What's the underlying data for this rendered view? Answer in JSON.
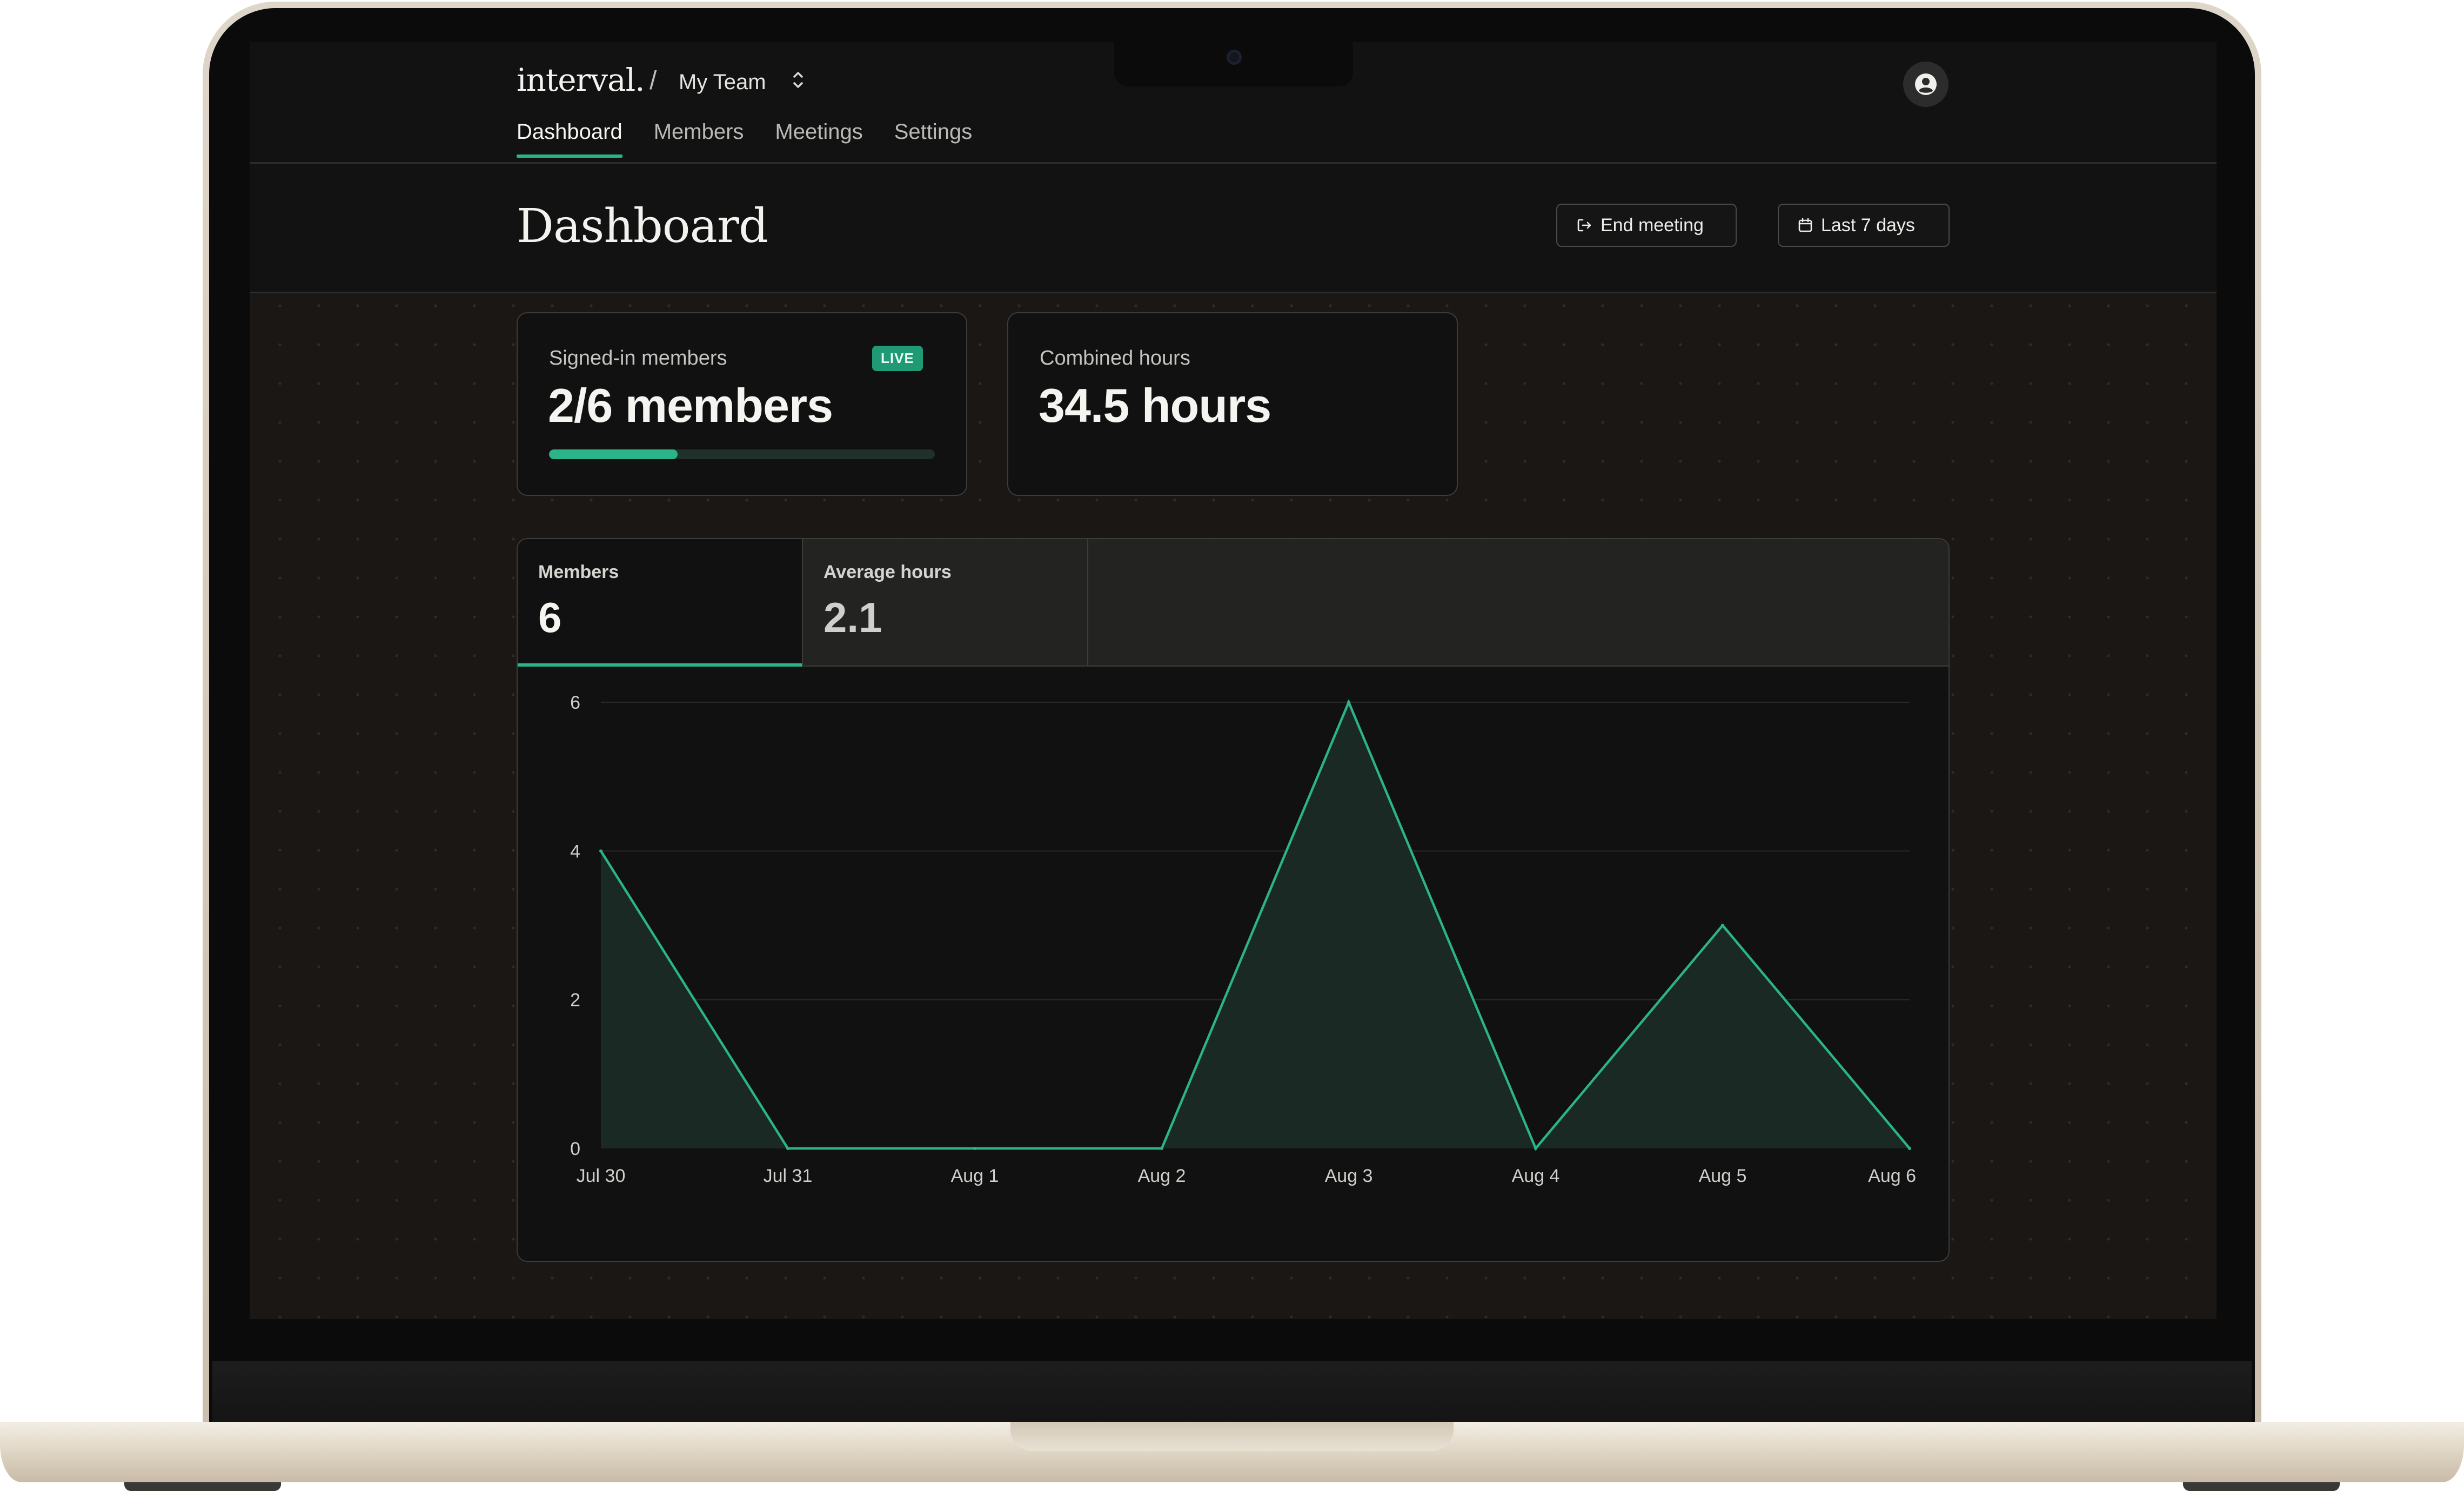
{
  "app": {
    "logo": "interval.",
    "team_separator": "/",
    "team_name": "My Team"
  },
  "nav": {
    "items": [
      {
        "label": "Dashboard",
        "active": true
      },
      {
        "label": "Members",
        "active": false
      },
      {
        "label": "Meetings",
        "active": false
      },
      {
        "label": "Settings",
        "active": false
      }
    ]
  },
  "header": {
    "title": "Dashboard",
    "end_meeting_label": "End meeting",
    "date_range_label": "Last 7 days"
  },
  "stats": {
    "signed_in": {
      "label": "Signed-in members",
      "badge": "LIVE",
      "value": "2/6 members",
      "progress_fraction": 0.333
    },
    "combined": {
      "label": "Combined hours",
      "value": "34.5 hours"
    }
  },
  "tabs": [
    {
      "label": "Members",
      "value": "6",
      "active": true
    },
    {
      "label": "Average hours",
      "value": "2.1",
      "active": false
    }
  ],
  "icons": {
    "team_switcher": "chevron-up-down-icon",
    "avatar": "user-circle-icon",
    "end_meeting": "sign-out-icon",
    "date_range": "calendar-icon"
  },
  "colors": {
    "accent": "#2bb38a",
    "badge": "#1f9a74",
    "area_fill": "#1a2924"
  },
  "chart_data": {
    "type": "area",
    "categories": [
      "Jul 30",
      "Jul 31",
      "Aug 1",
      "Aug 2",
      "Aug 3",
      "Aug 4",
      "Aug 5",
      "Aug 6"
    ],
    "series": [
      {
        "values": [
          4,
          0,
          0,
          0,
          6,
          0,
          3,
          0
        ]
      }
    ],
    "yticks": [
      0,
      2,
      4,
      6
    ],
    "ylim": [
      0,
      6
    ],
    "grid": true,
    "legend": "none"
  }
}
